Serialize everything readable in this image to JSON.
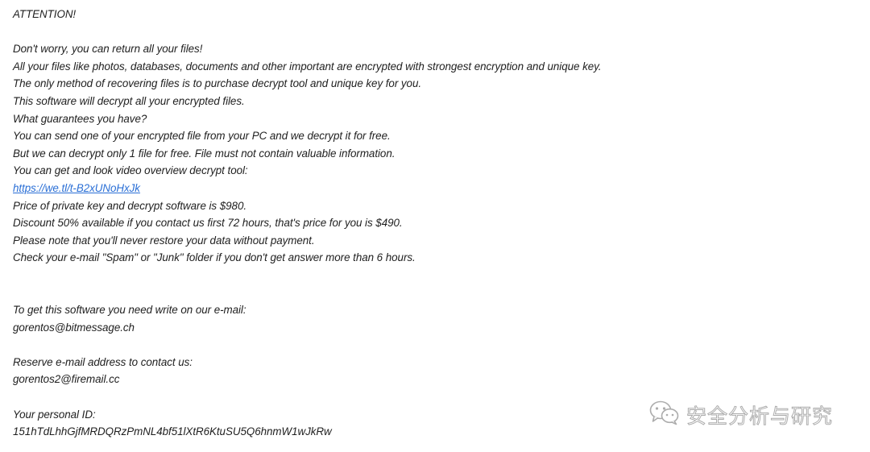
{
  "note": {
    "lines": [
      "ATTENTION!",
      "",
      "Don't worry, you can return all your files!",
      "All your files like photos, databases, documents and other important are encrypted with strongest encryption and unique key.",
      "The only method of recovering files is to purchase decrypt tool and unique key for you.",
      "This software will decrypt all your encrypted files.",
      "What guarantees you have?",
      "You can send one of your encrypted file from your PC and we decrypt it for free.",
      "But we can decrypt only 1 file for free. File must not contain valuable information.",
      "You can get and look video overview decrypt tool:",
      "https://we.tl/t-B2xUNoHxJk",
      "Price of private key and decrypt software is $980.",
      "Discount 50% available if you contact us first 72 hours, that's price for you is $490.",
      "Please note that you'll never restore your data without payment.",
      "Check your e-mail \"Spam\" or \"Junk\" folder if you don't get answer more than 6 hours.",
      "",
      "",
      "To get this software you need write on our e-mail:",
      "gorentos@bitmessage.ch",
      "",
      "Reserve e-mail address to contact us:",
      "gorentos2@firemail.cc",
      "",
      "Your personal ID:",
      "151hTdLhhGjfMRDQRzPmNL4bf51lXtR6KtuSU5Q6hnmW1wJkRw"
    ],
    "link_index": 10,
    "link_color": "#2a6fd6",
    "text_color": "#1f1f1f"
  },
  "watermark": {
    "icon": "wechat-icon",
    "text": "安全分析与研究"
  }
}
